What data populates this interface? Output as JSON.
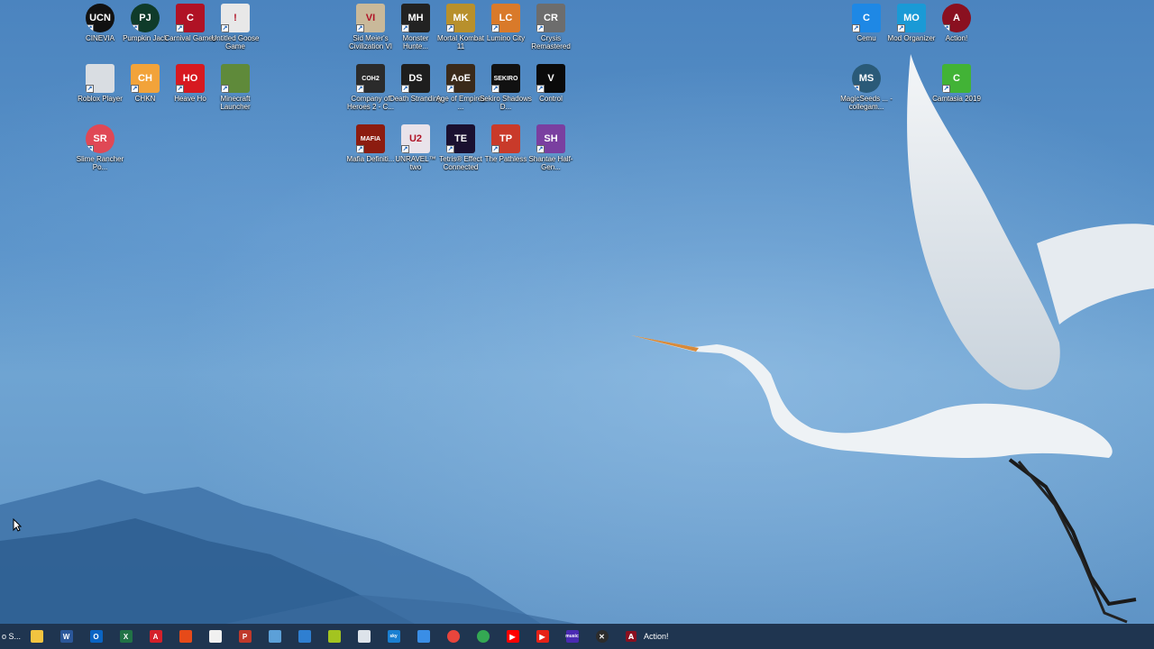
{
  "desktop_icons": [
    {
      "id": "cinevia",
      "label": "CINEVIA",
      "glyph": "UCN",
      "color": "#111111",
      "round": true
    },
    {
      "id": "pumpkin-jack",
      "label": "Pumpkin Jack",
      "glyph": "PJ",
      "color": "#0f3b2a",
      "round": true
    },
    {
      "id": "carnival-games",
      "label": "Carnival Games",
      "glyph": "C",
      "color": "#b01225",
      "round": false
    },
    {
      "id": "untitled-goose-game",
      "label": "Untitled Goose Game",
      "glyph": "!",
      "color": "#e8e8e8",
      "round": false
    },
    {
      "id": "roblox-player",
      "label": "Roblox Player",
      "glyph": "",
      "color": "#d9dde2",
      "round": false
    },
    {
      "id": "chkn",
      "label": "CHKN",
      "glyph": "CH",
      "color": "#f2a33a",
      "round": false
    },
    {
      "id": "heave-ho",
      "label": "Heave Ho",
      "glyph": "HO",
      "color": "#d71920",
      "round": false
    },
    {
      "id": "minecraft-launcher",
      "label": "Minecraft Launcher",
      "glyph": "",
      "color": "#5f8a3a",
      "round": false
    },
    {
      "id": "slime-rancher",
      "label": "Slime Rancher Po...",
      "glyph": "SR",
      "color": "#e04855",
      "round": true
    },
    {
      "id": "civilization-vi",
      "label": "Sid Meier's Civilization VI",
      "glyph": "VI",
      "color": "#c9b99a",
      "round": false
    },
    {
      "id": "monster-hunter",
      "label": "Monster Hunte...",
      "glyph": "MH",
      "color": "#222222",
      "round": false
    },
    {
      "id": "mortal-kombat-11",
      "label": "Mortal Kombat 11",
      "glyph": "MK",
      "color": "#b8902c",
      "round": false
    },
    {
      "id": "lumino-city",
      "label": "Lumino City",
      "glyph": "LC",
      "color": "#d97a2a",
      "round": false
    },
    {
      "id": "crysis-remastered",
      "label": "Crysis Remastered",
      "glyph": "CR",
      "color": "#6d6d6d",
      "round": false
    },
    {
      "id": "company-of-heroes-2",
      "label": "Company of Heroes 2 - C...",
      "glyph": "COH2",
      "color": "#2b2b2b",
      "round": false
    },
    {
      "id": "death-stranding",
      "label": "Death Stranding",
      "glyph": "DS",
      "color": "#1e1e1e",
      "round": false
    },
    {
      "id": "age-of-empires",
      "label": "Age of Empires ...",
      "glyph": "AoE",
      "color": "#3a2a1a",
      "round": false
    },
    {
      "id": "sekiro",
      "label": "Sekiro Shadows D...",
      "glyph": "SEKIRO",
      "color": "#111111",
      "round": false
    },
    {
      "id": "control",
      "label": "Control",
      "glyph": "V",
      "color": "#0a0a0a",
      "round": false
    },
    {
      "id": "mafia",
      "label": "Mafia Definiti...",
      "glyph": "MAFIA",
      "color": "#8c1c10",
      "round": false
    },
    {
      "id": "unravel-two",
      "label": "UNRAVEL™ two",
      "glyph": "U2",
      "color": "#e9e3ea",
      "round": false
    },
    {
      "id": "tetris-effect",
      "label": "Tetris® Effect Connected",
      "glyph": "TE",
      "color": "#1a1030",
      "round": false
    },
    {
      "id": "the-pathless",
      "label": "The Pathless",
      "glyph": "TP",
      "color": "#c93a2a",
      "round": false
    },
    {
      "id": "shantae",
      "label": "Shantae Half-Gen...",
      "glyph": "SH",
      "color": "#7a3fa0",
      "round": false
    },
    {
      "id": "cemu",
      "label": "Cemu",
      "glyph": "C",
      "color": "#1e88e5",
      "round": false
    },
    {
      "id": "mod-organizer",
      "label": "Mod Organizer",
      "glyph": "MO",
      "color": "#1a9ad6",
      "round": false
    },
    {
      "id": "action",
      "label": "Action!",
      "glyph": "A",
      "color": "#8a1020",
      "round": true
    },
    {
      "id": "magicseeds",
      "label": "MagicSeeds ... - collegam...",
      "glyph": "MS",
      "color": "#2a5a78",
      "round": true
    },
    {
      "id": "camtasia",
      "label": "Camtasia 2019",
      "glyph": "C",
      "color": "#42b336",
      "round": false
    }
  ],
  "taskbar": {
    "search_text": "o S...",
    "items": [
      {
        "id": "file-explorer",
        "glyph": "",
        "color": "#f2c440",
        "round": false
      },
      {
        "id": "word",
        "glyph": "W",
        "color": "#2b579a",
        "round": false
      },
      {
        "id": "outlook",
        "glyph": "O",
        "color": "#0a64c4",
        "round": false
      },
      {
        "id": "excel",
        "glyph": "X",
        "color": "#217346",
        "round": false
      },
      {
        "id": "acrobat",
        "glyph": "A",
        "color": "#d4202a",
        "round": false
      },
      {
        "id": "office",
        "glyph": "",
        "color": "#e64a19",
        "round": false
      },
      {
        "id": "store",
        "glyph": "",
        "color": "#f0f0f0",
        "round": false
      },
      {
        "id": "app-red-blue",
        "glyph": "P",
        "color": "#c0392b",
        "round": false
      },
      {
        "id": "app-blue",
        "glyph": "",
        "color": "#5ca0d8",
        "round": false
      },
      {
        "id": "mail",
        "glyph": "",
        "color": "#2f7fd1",
        "round": false
      },
      {
        "id": "app-green-yellow",
        "glyph": "",
        "color": "#a3c420",
        "round": false
      },
      {
        "id": "app-white",
        "glyph": "",
        "color": "#dde3ea",
        "round": false
      },
      {
        "id": "sky",
        "glyph": "sky",
        "color": "#1a7fd1",
        "round": false
      },
      {
        "id": "phone-link",
        "glyph": "",
        "color": "#3a8ee6",
        "round": false
      },
      {
        "id": "chrome",
        "glyph": "",
        "color": "#e8453c",
        "round": true
      },
      {
        "id": "chrome-2",
        "glyph": "",
        "color": "#34a853",
        "round": true
      },
      {
        "id": "youtube",
        "glyph": "▶",
        "color": "#ff0000",
        "round": false
      },
      {
        "id": "youtube-2",
        "glyph": "▶",
        "color": "#e62117",
        "round": false
      },
      {
        "id": "amazon-music",
        "glyph": "music",
        "color": "#4a2ab3",
        "round": false
      },
      {
        "id": "xbox",
        "glyph": "✕",
        "color": "#2c2c2c",
        "round": true
      }
    ],
    "running_app": {
      "glyph": "A",
      "label": "Action!"
    }
  }
}
